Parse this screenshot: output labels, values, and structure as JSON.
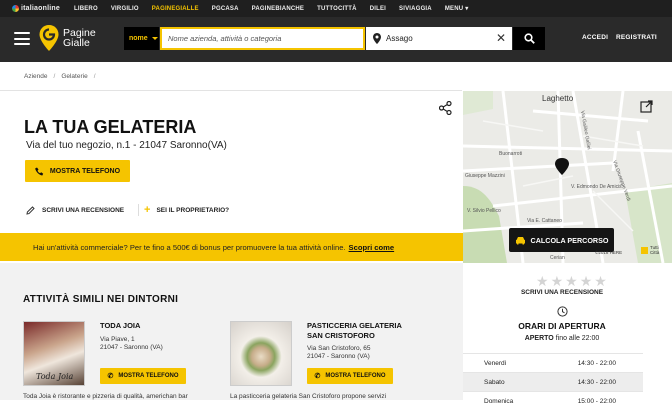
{
  "topbar": {
    "logo": "italiaonline",
    "items": [
      "LIBERO",
      "VIRGILIO",
      "PAGINEGIALLE",
      "PGCASA",
      "PAGINEBIANCHE",
      "TUTTOCITTÀ",
      "DILEI",
      "SIVIAGGIA",
      "MENU"
    ]
  },
  "header": {
    "brand_line1": "Pagine",
    "brand_line2": "Gialle",
    "category": "nome",
    "search_placeholder": "Nome azienda, attività o categoria",
    "location": "Assago",
    "login": "ACCEDI",
    "register": "REGISTRATI"
  },
  "breadcrumb": [
    "Aziende",
    "/",
    "Gelaterie",
    "/"
  ],
  "business": {
    "name": "LA TUA GELATERIA",
    "address": "Via del tuo negozio, n.1 - 21047 Saronno(VA)",
    "phone_button": "MOSTRA TELEFONO",
    "review_link": "SCRIVI UNA RECENSIONE",
    "owner_link": "SEI IL PROPRIETARIO?"
  },
  "promo": {
    "text": "Hai un'attività commerciale? Per te fino a 500€ di bonus per promuovere la tua attività online.",
    "link": "Scopri come"
  },
  "map": {
    "labels": [
      "Laghetto",
      "Buonarroti",
      "Giuseppe Mazzini",
      "V. Silvio Pellico",
      "Via E. Cattaneo",
      "V. Edmondo De Amicis",
      "Via Galileo Galilei",
      "Via Giuseppe Verdi",
      "Cerian"
    ],
    "route_button": "CALCOLA PERCORSO",
    "copyright": "©2018 HERE",
    "tutti": "Tutti",
    "citta": "Città"
  },
  "similar": {
    "title": "ATTIVITÀ SIMILI NEI DINTORNI",
    "cards": [
      {
        "name_line1": "TODA JOIA",
        "name_line2": "",
        "addr_line1": "Via Piave, 1",
        "addr_line2": "21047 - Saronno (VA)",
        "button": "MOSTRA TELEFONO",
        "desc": "Toda Joia è ristorante e pizzeria di qualità, americhan bar",
        "img_caption": "Toda Joia"
      },
      {
        "name_line1": "PASTICCERIA GELATERIA",
        "name_line2": "SAN CRISTOFORO",
        "addr_line1": "Via San Cristoforo, 65",
        "addr_line2": "21047 - Saronno (VA)",
        "button": "MOSTRA TELEFONO",
        "desc": "La pasticceria gelateria San Cristoforo propone servizi"
      }
    ]
  },
  "sidebar": {
    "review_cta": "SCRIVI UNA RECENSIONE",
    "hours_title": "ORARI DI APERTURA",
    "open_status": "APERTO",
    "open_until": "fino alle 22:00",
    "hours": [
      {
        "day": "Venerdì",
        "time": "14:30 - 22:00"
      },
      {
        "day": "Sabato",
        "time": "14:30 - 22:00"
      },
      {
        "day": "Domenica",
        "time": "15:00 - 22:00"
      }
    ]
  },
  "colors": {
    "accent": "#f5c400",
    "dark": "#2a2a2a",
    "topbar": "#1f1f1f"
  }
}
